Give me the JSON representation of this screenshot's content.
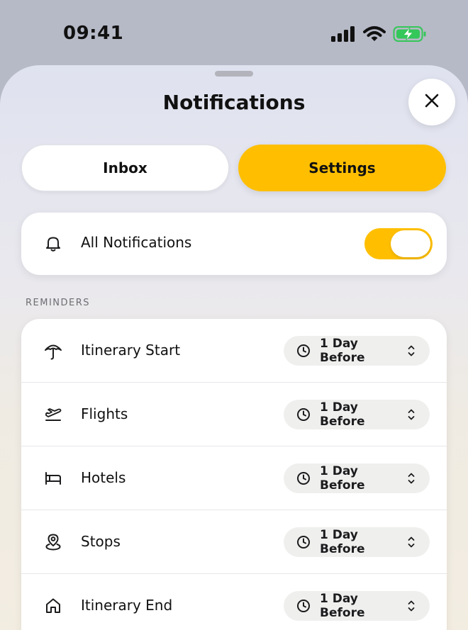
{
  "status_bar": {
    "time": "09:41",
    "icons": [
      "signal-icon",
      "wifi-icon",
      "battery-charging-icon"
    ]
  },
  "header": {
    "title": "Notifications",
    "close_icon": "close-icon"
  },
  "tabs": [
    {
      "label": "Inbox",
      "selected": false
    },
    {
      "label": "Settings",
      "selected": true
    }
  ],
  "all_notifications": {
    "icon": "bell-icon",
    "label": "All Notifications",
    "enabled": true
  },
  "reminders": {
    "section_title": "REMINDERS",
    "items": [
      {
        "icon": "umbrella-icon",
        "label": "Itinerary Start",
        "value": "1 Day Before"
      },
      {
        "icon": "plane-takeoff-icon",
        "label": "Flights",
        "value": "1 Day Before"
      },
      {
        "icon": "bed-icon",
        "label": "Hotels",
        "value": "1 Day Before"
      },
      {
        "icon": "map-pin-icon",
        "label": "Stops",
        "value": "1 Day Before"
      },
      {
        "icon": "home-icon",
        "label": "Itinerary End",
        "value": "1 Day Before"
      }
    ]
  },
  "colors": {
    "accent": "#ffbf00",
    "sheet_top": "#dfe2ef",
    "sheet_bottom": "#f3ede1"
  }
}
